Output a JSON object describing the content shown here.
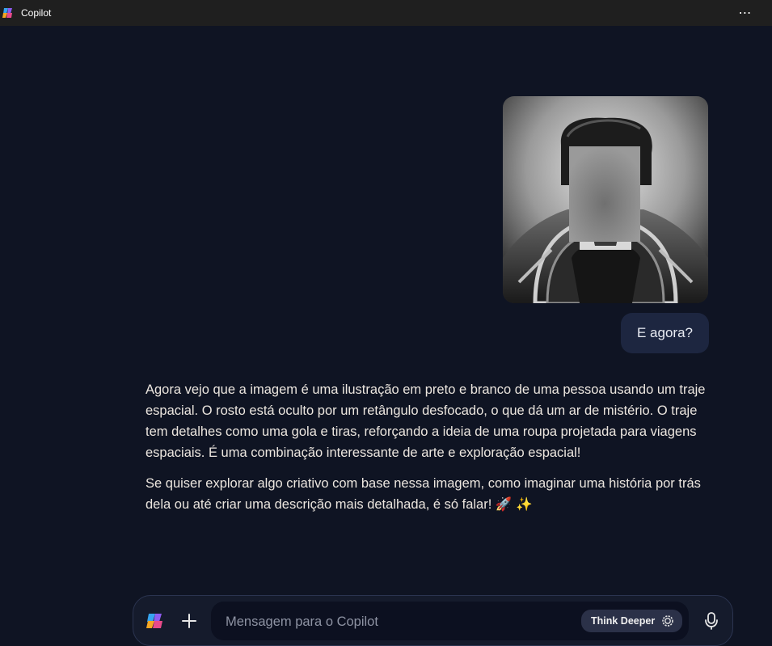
{
  "window": {
    "title": "Copilot",
    "more_label": "⋯"
  },
  "conversation": {
    "user_image_icon": "astronaut-portrait-image",
    "user_message": "E agora?",
    "assistant_paragraphs": [
      "Agora vejo que a imagem é uma ilustração em preto e branco de uma pessoa usando um traje espacial. O rosto está oculto por um retângulo desfocado, o que dá um ar de mistério. O traje tem detalhes como uma gola e tiras, reforçando a ideia de uma roupa projetada para viagens espaciais. É uma combinação interessante de arte e exploração espacial!",
      "Se quiser explorar algo criativo com base nessa imagem, como imaginar uma história por trás dela ou até criar uma descrição mais detalhada, é só falar! 🚀 ✨"
    ]
  },
  "composer": {
    "placeholder": "Mensagem para o Copilot",
    "value": "",
    "think_deeper_label": "Think Deeper",
    "icons": {
      "copilot": "copilot-logo-icon",
      "add": "plus-icon",
      "think": "gear-icon",
      "mic": "microphone-icon"
    }
  },
  "colors": {
    "background": "#0f1423",
    "titlebar": "#1f1f1f",
    "user_bubble": "#1d2640",
    "composer": "#151b2c",
    "input": "#0c1020",
    "think_button": "#2b3148"
  }
}
